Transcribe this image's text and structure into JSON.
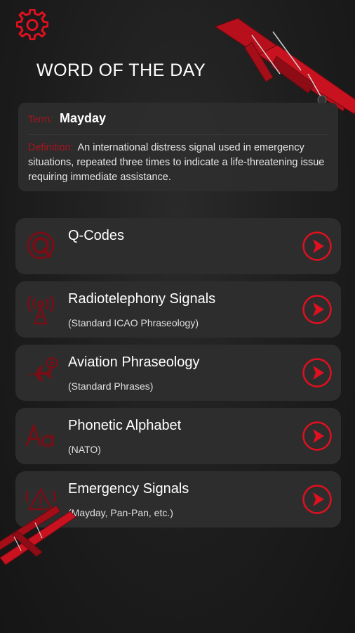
{
  "app": {
    "accent_color": "#e0101f",
    "settings_icon": "gear-icon"
  },
  "word_of_the_day": {
    "heading": "WORD OF THE DAY",
    "term_label": "Term:",
    "term": "Mayday",
    "definition_label": "Definition:",
    "definition": "An international distress signal used in emergency situations, repeated three times to indicate a life-threatening issue requiring immediate assistance."
  },
  "menu": [
    {
      "title": "Q-Codes",
      "subtitle": "",
      "icon": "q-code-icon"
    },
    {
      "title": "Radiotelephony Signals",
      "subtitle": "(Standard ICAO Phraseology)",
      "icon": "radio-tower-icon"
    },
    {
      "title": "Aviation Phraseology",
      "subtitle": "(Standard Phrases)",
      "icon": "airplane-chat-icon"
    },
    {
      "title": "Phonetic Alphabet",
      "subtitle": "(NATO)",
      "icon": "alphabet-icon"
    },
    {
      "title": "Emergency Signals",
      "subtitle": "(Mayday, Pan-Pan, etc.)",
      "icon": "warning-icon"
    }
  ]
}
